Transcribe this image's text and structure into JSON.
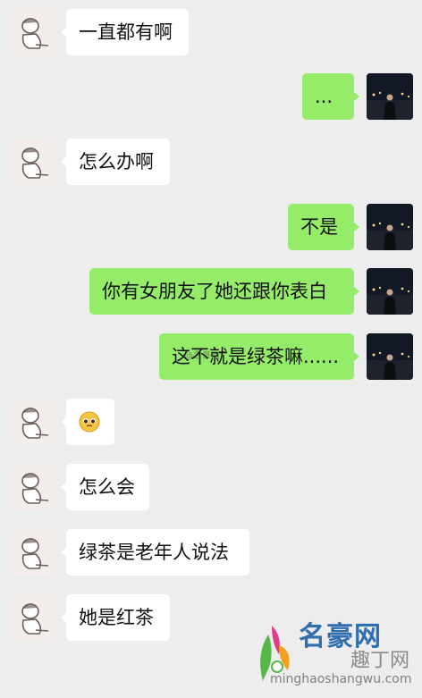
{
  "messages": [
    {
      "side": "in",
      "text": "一直都有啊"
    },
    {
      "side": "out",
      "text": "..."
    },
    {
      "side": "in",
      "text": "怎么办啊"
    },
    {
      "side": "out",
      "text": "不是"
    },
    {
      "side": "out",
      "text": "你有女朋友了她还跟你表白"
    },
    {
      "side": "out",
      "text": "这不就是绿茶嘛......",
      "watermark": "@名豪网"
    },
    {
      "side": "in",
      "emoji": "pleading-face-emoji"
    },
    {
      "side": "in",
      "text": "怎么会"
    },
    {
      "side": "in",
      "text": "绿茶是老年人说法"
    },
    {
      "side": "in",
      "text": "她是红茶"
    }
  ],
  "site_watermark": {
    "title": "名豪网",
    "subtitle": "趣丁网",
    "url": "minghaoshangwu.com"
  }
}
